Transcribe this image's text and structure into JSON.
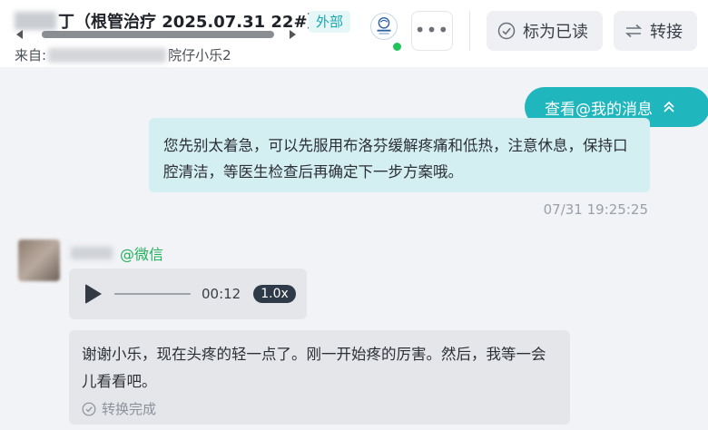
{
  "header": {
    "title_blurred_prefix": "",
    "title": "丁（根管治疗 2025.07.31 22#）",
    "external_tag": "外部",
    "from_label": "来自:",
    "from_suffix": "院仔小乐2",
    "logo_icon": "clinic-logo-icon",
    "online_status_color": "#21c45a",
    "more_label": "•••",
    "mark_read_label": "标为已读",
    "transfer_label": "转接"
  },
  "chat": {
    "mention_pill_label": "查看@我的消息",
    "outgoing_message": "您先别太着急，可以先服用布洛芬缓解疼痛和低热，注意休息，保持口腔清洁，等医生检查后再确定下一步方案哦。",
    "outgoing_time": "07/31 19:25:25",
    "sender_source": "@微信",
    "voice_duration": "00:12",
    "voice_speed": "1.0x",
    "incoming_message": "谢谢小乐，现在头疼的轻一点了。刚一开始疼的厉害。然后，我等一会儿看看吧。",
    "convert_status": "转换完成"
  },
  "colors": {
    "accent": "#1fb6bd",
    "outgoing_bubble": "#d4eff2",
    "incoming_bubble": "#e4e6ea",
    "wechat_green": "#21b15b"
  }
}
